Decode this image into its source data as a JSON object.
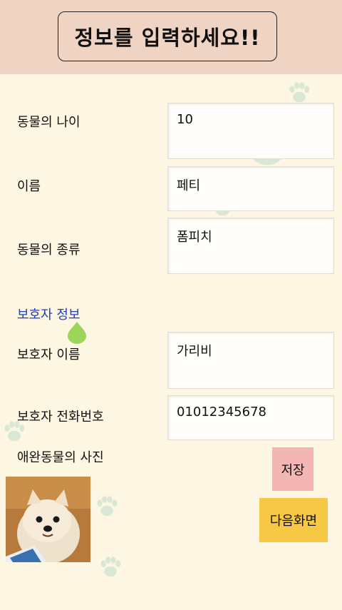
{
  "header": {
    "title": "정보를 입력하세요!!"
  },
  "form": {
    "animal_age": {
      "label": "동물의 나이",
      "value": "10"
    },
    "name": {
      "label": "이름",
      "value": "페티"
    },
    "animal_type": {
      "label": "동물의 종류",
      "value": "폼피치"
    },
    "guardian_section": "보호자 정보",
    "guardian_name": {
      "label": "보호자 이름",
      "value": "가리비"
    },
    "guardian_phone": {
      "label": "보호자 전화번호",
      "value": "01012345678"
    },
    "pet_photo_label": "애완동물의 사진"
  },
  "buttons": {
    "save": "저장",
    "next": "다음화면"
  },
  "colors": {
    "header_bg": "#efd3c3",
    "page_bg": "#fdf6e3",
    "save_btn": "#f4b6b3",
    "next_btn": "#f6c843",
    "section_text": "#1f3fb5"
  }
}
